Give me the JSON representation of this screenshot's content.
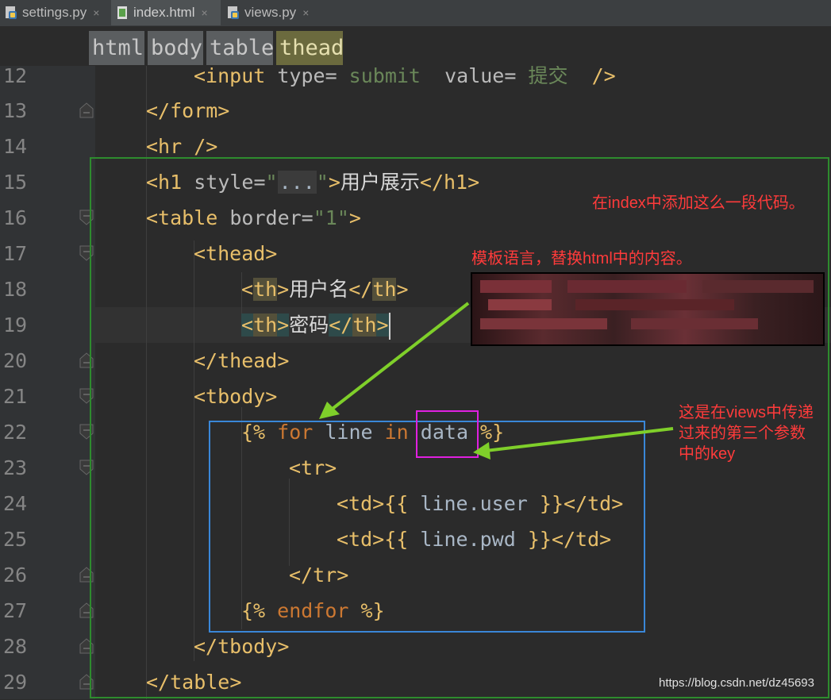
{
  "tabs": [
    {
      "name": "settings.py",
      "close": "×",
      "icon": "python-file-icon"
    },
    {
      "name": "index.html",
      "close": "×",
      "icon": "html-file-icon"
    },
    {
      "name": "views.py",
      "close": "×",
      "icon": "python-file-icon"
    }
  ],
  "breadcrumbs": [
    "html",
    "body",
    "table",
    "thead"
  ],
  "line_numbers": [
    "12",
    "13",
    "14",
    "15",
    "16",
    "17",
    "18",
    "19",
    "20",
    "21",
    "22",
    "23",
    "24",
    "25",
    "26",
    "27",
    "28",
    "29"
  ],
  "code": {
    "l12": {
      "open": "<input ",
      "a1": "type=",
      "v1": " submit ",
      "a2": " value=",
      "v2": " 提交 ",
      "close": " />"
    },
    "l13": "</form>",
    "l14": "<hr />",
    "l15": {
      "open": "<h1 ",
      "attr": "style=",
      "q1": "\"",
      "folded": "...",
      "q2": "\"",
      "gt": ">",
      "text": "用户展示",
      "close": "</h1>"
    },
    "l16": {
      "open": "<table ",
      "attr": "border=",
      "val": "\"1\"",
      "gt": ">"
    },
    "l17": "<thead>",
    "l18": {
      "o1": "<",
      "t1": "th",
      "g1": ">",
      "text": "用户名",
      "o2": "</",
      "t2": "th",
      "g2": ">"
    },
    "l19": {
      "o1": "<",
      "t1": "th",
      "g1": ">",
      "text": "密码",
      "o2": "</",
      "t2": "th",
      "g2": ">"
    },
    "l20": "</thead>",
    "l21": "<tbody>",
    "l22": {
      "b1": "{% ",
      "k1": "for",
      "sp1": " line ",
      "k2": "in",
      "sp2": " data ",
      "b2": "%}"
    },
    "l23": "<tr>",
    "l24": {
      "open": "<td>",
      "b1": "{{",
      "expr": " line.user ",
      "b2": "}}",
      "close": "</td>"
    },
    "l25": {
      "open": "<td>",
      "b1": "{{",
      "expr": " line.pwd ",
      "b2": "}}",
      "close": "</td>"
    },
    "l26": "</tr>",
    "l27": {
      "b1": "{% ",
      "k1": "endfor",
      "b2": " %}"
    },
    "l28": "</tbody>",
    "l29": "</table>"
  },
  "annotations": {
    "note1": "在index中添加这么一段代码。",
    "note2": "模板语言，替换html中的内容。",
    "note3_lines": [
      "这是在views中传递",
      "过来的第三个参数",
      "中的key"
    ]
  },
  "watermark": "https://blog.csdn.net/dz45693",
  "colors": {
    "green_box": "#2e8b2e",
    "blue_box": "#3a87d8",
    "magenta_box": "#e020e0",
    "arrow": "#7fcf2a",
    "note_text": "#ff3b3b"
  }
}
